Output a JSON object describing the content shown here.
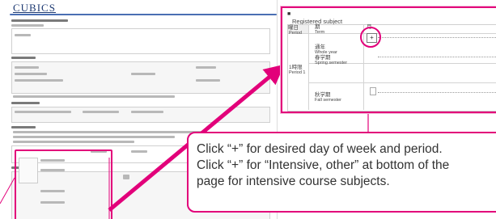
{
  "background_screen": {
    "app_logo": "CUBICS"
  },
  "zoom_panel": {
    "section_marker": "■",
    "subtitle": "Registered subject",
    "col_day_label": "曜日",
    "col_day_label_en": "Period",
    "col_term_label": "期",
    "col_term_label_en": "Term",
    "col_mark": "月",
    "row1_jp": "通年",
    "row1_en": "Whole year",
    "row2_jp": "春学期",
    "row2_en": "Spring semester",
    "row_group_jp": "1時限",
    "row_group_en": "Period 1",
    "row3_jp": "秋学期",
    "row3_en": "Fall semester",
    "plus_label": "+"
  },
  "callout": {
    "line1": "Click “+” for desired day of week and period.",
    "line2": "Click “+” for “Intensive, other” at bottom of the",
    "line3": "page  for intensive course subjects."
  },
  "colors": {
    "accent": "#e2007a",
    "logo": "#1f3b73"
  }
}
